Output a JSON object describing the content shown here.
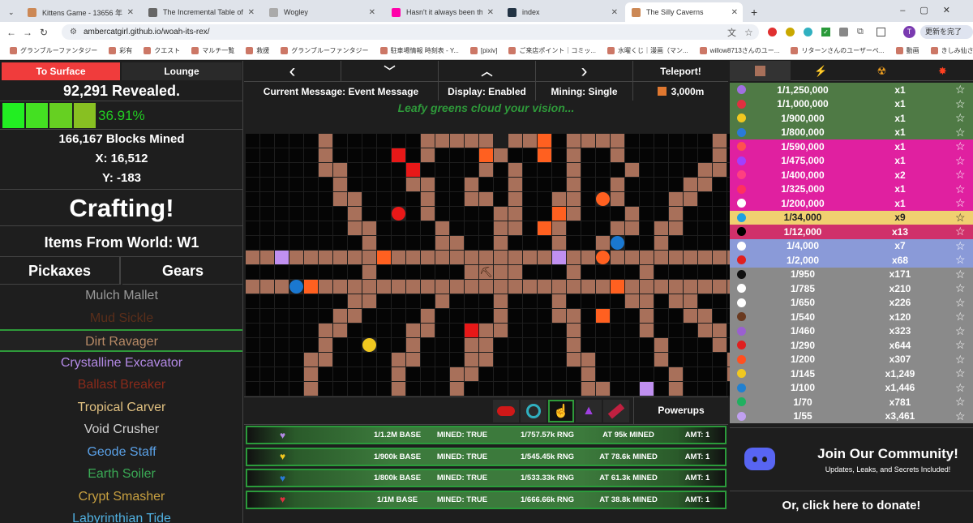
{
  "browser": {
    "tabs": [
      {
        "title": "Kittens Game - 13656 年目 - 夏",
        "color": "#c85"
      },
      {
        "title": "The Incremental Table of Eleme",
        "color": "#666"
      },
      {
        "title": "Wogley",
        "color": "#aaa"
      },
      {
        "title": "Hasn't it always been there?",
        "color": "#f0a"
      },
      {
        "title": "index",
        "color": "#234"
      },
      {
        "title": "The Silly Caverns",
        "color": "#c85"
      }
    ],
    "new_tab": "+",
    "url": "ambercatgirl.github.io/woah-its-rex/",
    "update_label": "更新を完了",
    "avatar_letter": "T",
    "bookmarks": [
      "グランブルーファンタジー",
      "彩有",
      "クエスト",
      "マルチ一覧",
      "救援",
      "グランブルーファンタジー",
      "駐車場情報 時刻表 - Y...",
      "[pixiv]",
      "ご来店ポイント｜コミッ...",
      "水曜くじ｜漫画（マン...",
      "willow8713さんのユー...",
      "リターンさんのユーザーペ...",
      "動画",
      "きしみ仙さんのユーザ...",
      "HYさんのユーザーページ..."
    ]
  },
  "left": {
    "to_surface": "To Surface",
    "lounge": "Lounge",
    "revealed": "92,291 Revealed.",
    "progress_percent": "36.91%",
    "progress_value": 36.91,
    "blocks_mined": "166,167 Blocks Mined",
    "x": "X: 16,512",
    "y": "Y: -183",
    "crafting": "Crafting!",
    "items_from_world": "Items From World: W1",
    "tab_pickaxes": "Pickaxes",
    "tab_gears": "Gears",
    "tools": [
      {
        "name": "Mulch Mallet",
        "color": "#9a9a9a"
      },
      {
        "name": "Mud Sickle",
        "color": "#5a2e1a"
      },
      {
        "name": "Dirt Ravager",
        "color": "#b88a66"
      },
      {
        "name": "Crystalline Excavator",
        "color": "#b48ae6"
      },
      {
        "name": "Ballast Breaker",
        "color": "#8a2a1a"
      },
      {
        "name": "Tropical Carver",
        "color": "#e0c080"
      },
      {
        "name": "Void Crusher",
        "color": "#d0d0d0"
      },
      {
        "name": "Geode Staff",
        "color": "#5aa0e6"
      },
      {
        "name": "Earth Soiler",
        "color": "#3aaa55"
      },
      {
        "name": "Crypt Smasher",
        "color": "#c8a040"
      },
      {
        "name": "Labyrinthian Tide",
        "color": "#50b0e0"
      }
    ]
  },
  "center": {
    "prev": "‹",
    "collapse": "︿",
    "next": "›",
    "teleport": "Teleport!",
    "current_message": "Current Message: Event Message",
    "display": "Display: Enabled",
    "mining": "Mining: Single",
    "depth": "3,000m",
    "event_text": "Leafy greens cloud your vision...",
    "powerups_label": "Powerups",
    "powerups": [
      {
        "icon": "purple-heart-icon",
        "color": "#b48ae6",
        "base": "1/1.2M BASE",
        "mined": "MINED: TRUE",
        "rng": "1/757.57k RNG",
        "at": "AT 95k MINED",
        "amt": "AMT: 1"
      },
      {
        "icon": "yellow-heart-icon",
        "color": "#f0c820",
        "base": "1/900k BASE",
        "mined": "MINED: TRUE",
        "rng": "1/545.45k RNG",
        "at": "AT 78.6k MINED",
        "amt": "AMT: 1"
      },
      {
        "icon": "blue-heart-icon",
        "color": "#2a7ad8",
        "base": "1/800k BASE",
        "mined": "MINED: TRUE",
        "rng": "1/533.33k RNG",
        "at": "AT 61.3k MINED",
        "amt": "AMT: 1"
      },
      {
        "icon": "red-heart-icon",
        "color": "#e03040",
        "base": "1/1M BASE",
        "mined": "MINED: TRUE",
        "rng": "1/666.66k RNG",
        "at": "AT 38.8k MINED",
        "amt": "AMT: 1"
      }
    ]
  },
  "right": {
    "ores": [
      {
        "rarity": "1/1,250,000",
        "count": "x1",
        "bg": "#4f7a45",
        "dot": "#a070e0"
      },
      {
        "rarity": "1/1,000,000",
        "count": "x1",
        "bg": "#4f7a45",
        "dot": "#e03040"
      },
      {
        "rarity": "1/900,000",
        "count": "x1",
        "bg": "#4f7a45",
        "dot": "#f0c820"
      },
      {
        "rarity": "1/800,000",
        "count": "x1",
        "bg": "#4f7a45",
        "dot": "#2a7ad8"
      },
      {
        "rarity": "1/590,000",
        "count": "x1",
        "bg": "#e020a0",
        "dot": "#ff5050"
      },
      {
        "rarity": "1/475,000",
        "count": "x1",
        "bg": "#e020a0",
        "dot": "#a040ff"
      },
      {
        "rarity": "1/400,000",
        "count": "x2",
        "bg": "#e020a0",
        "dot": "#ff4080"
      },
      {
        "rarity": "1/325,000",
        "count": "x1",
        "bg": "#e020a0",
        "dot": "#ff3060"
      },
      {
        "rarity": "1/200,000",
        "count": "x1",
        "bg": "#e020a0",
        "dot": "#ffffff"
      },
      {
        "rarity": "1/34,000",
        "count": "x9",
        "bg": "#f0d070",
        "dot": "#20a0e0",
        "dark": true
      },
      {
        "rarity": "1/12,000",
        "count": "x13",
        "bg": "#d0306a",
        "dot": "#000000"
      },
      {
        "rarity": "1/4,000",
        "count": "x7",
        "bg": "#8a9ad8",
        "dot": "#ffffff"
      },
      {
        "rarity": "1/2,000",
        "count": "x68",
        "bg": "#8a9ad8",
        "dot": "#e02020"
      },
      {
        "rarity": "1/950",
        "count": "x171",
        "bg": "#8a8a8a",
        "dot": "#111111"
      },
      {
        "rarity": "1/785",
        "count": "x210",
        "bg": "#8a8a8a",
        "dot": "#ffffff"
      },
      {
        "rarity": "1/650",
        "count": "x226",
        "bg": "#8a8a8a",
        "dot": "#ffffff"
      },
      {
        "rarity": "1/540",
        "count": "x120",
        "bg": "#8a8a8a",
        "dot": "#6a3a20"
      },
      {
        "rarity": "1/460",
        "count": "x323",
        "bg": "#8a8a8a",
        "dot": "#9a60d0"
      },
      {
        "rarity": "1/290",
        "count": "x644",
        "bg": "#8a8a8a",
        "dot": "#e02020"
      },
      {
        "rarity": "1/200",
        "count": "x307",
        "bg": "#8a8a8a",
        "dot": "#ff5020"
      },
      {
        "rarity": "1/145",
        "count": "x1,249",
        "bg": "#8a8a8a",
        "dot": "#f0c820"
      },
      {
        "rarity": "1/100",
        "count": "x1,446",
        "bg": "#8a8a8a",
        "dot": "#2080d0"
      },
      {
        "rarity": "1/70",
        "count": "x781",
        "bg": "#8a8a8a",
        "dot": "#20b060"
      },
      {
        "rarity": "1/55",
        "count": "x3,461",
        "bg": "#8a8a8a",
        "dot": "#c0a0f0"
      }
    ],
    "star": "☆",
    "community_title": "Join Our Community!",
    "community_sub": "Updates, Leaks, and Secrets Included!",
    "donate": "Or, click here to donate!"
  },
  "grid": {
    "dark": "#050505",
    "brown": "#a8705a",
    "rows": [
      "nnnnnBnnnnnnBBBBB..BnnBBBBnnnnnnBnnnnn",
      "nnnnnBnnnnnRBnnnBBRnnnBnOBnnnnnnBnnnnn",
      "nnnnnBBnnnnBRnnnBnBnnnBnnnBnnnnBBnnnnn",
      "nnnnnnBnnnnBBnnBnnBnnnBnnBnnnnBBnnnnnn",
      "nnnnnnBBnnnnBnnBBnBnnBBnnBnnnBBnnnnnnn",
      "nnnnnnnBnnnnBnnnnBBnnBBnnnBnnBnnnnnnnn",
      "nnnnnnnBBnnnnBnnnBBnnBnnnBBnBBnnnnnnnn",
      "nnnnnnnnBnnnnBBnnBnnnBnnBnnnBnnnnnnnnn",
      "BBBBBBBBBBBBBBBBBBBBBBBBBBBBBBBBBBBBBB",
      "nnnnnnnnBnnnnnnBBnBnnnBnnnnBnnnnnnnnnn",
      "BBBBBBBBBBBBBBBBBBBBBBBBBBBBBBBBBBBBBB",
      "nnnnnnnBBnnnnBnnnBnnnBnnnnBBnBBnnnnnnn",
      "nnnnnnBBnnnnBnnnnBnnnBBnnnnBnnBBnnnnnn",
      "nnnnnBBnnnnBBnnnBBnnnnBnnnnBnnnBBnnnnn",
      "nnnnnBnnnnnBnnnBBRnnnnBnnnnnBnnnBnnnnn",
      "nnnnBBnnnnBBnnnBBnnnnnBBnnnnBnnnnBnnnn",
      "nnnnBnnnnnBnnnBBnnnnnnnBnnnnnBnnnBnnnn",
      "nnnnBnnnnnBnnnBnnnnnnnnBBnnnnBnnnnBnnn"
    ]
  }
}
